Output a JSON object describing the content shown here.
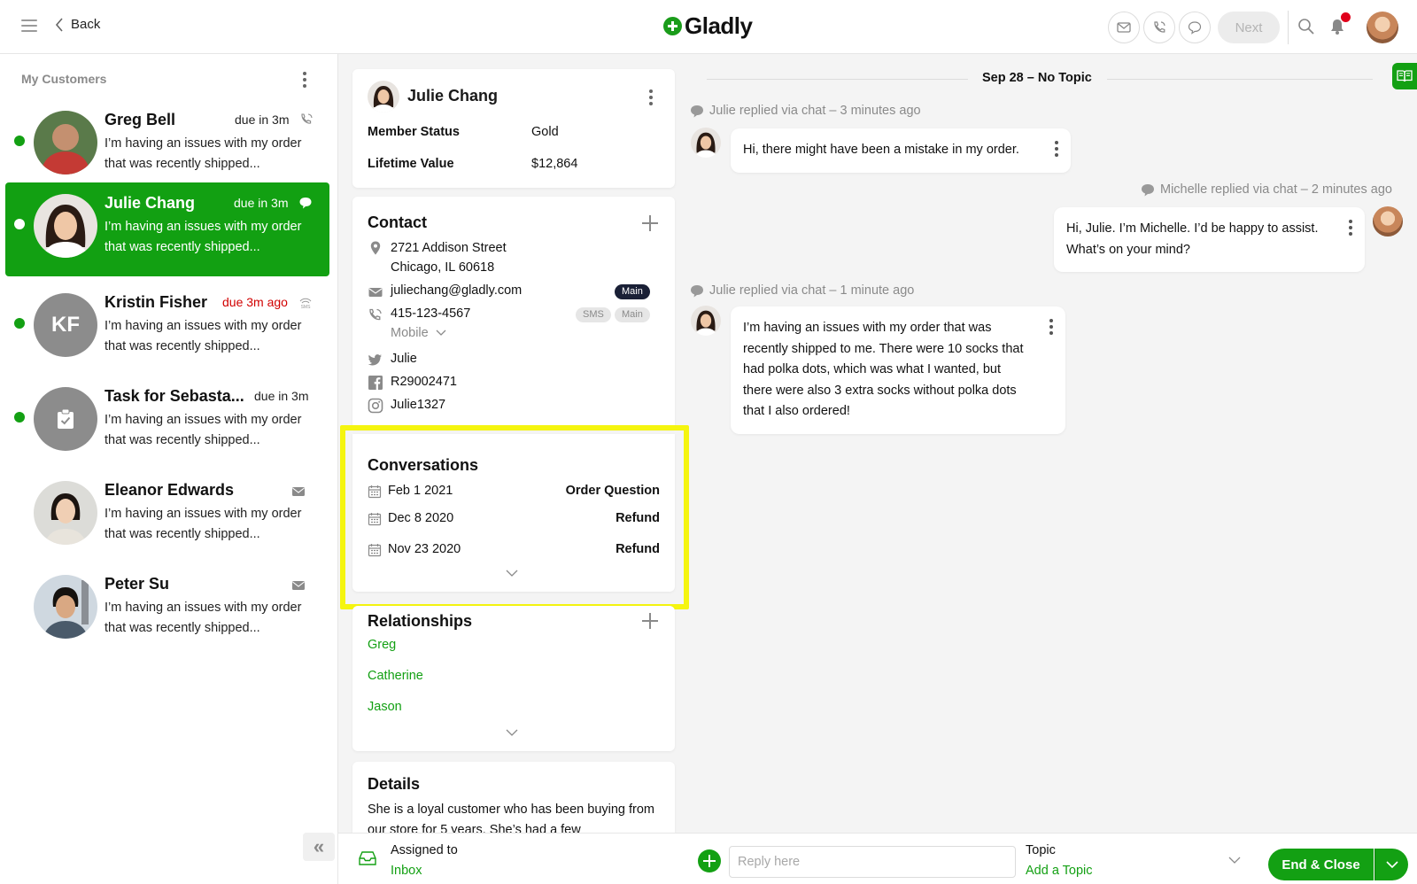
{
  "topbar": {
    "back_label": "Back",
    "logo_text": "Gladly",
    "next_label": "Next"
  },
  "sidebar": {
    "header": "My Customers",
    "customers": [
      {
        "name": "Greg Bell",
        "due": "due in 3m",
        "preview": "I’m having an issues with my order that was recently shipped...",
        "channel_icon": "phone-icon",
        "status": "online"
      },
      {
        "name": "Julie Chang",
        "due": "due in 3m",
        "preview": "I’m having an issues with my order that was recently shipped...",
        "channel_icon": "chat-icon",
        "status": "active"
      },
      {
        "name": "Kristin Fisher",
        "initials": "KF",
        "due": "due 3m ago",
        "preview": "I’m having an issues with my order that was recently shipped...",
        "channel_icon": "sms-icon",
        "status": "online"
      },
      {
        "name": "Task for Sebasta...",
        "due": "due in 3m",
        "preview": "I’m having an issues with my order that was recently shipped...",
        "channel_icon": "",
        "status": "online"
      },
      {
        "name": "Eleanor Edwards",
        "due": "",
        "preview": "I’m having an issues with my order that was recently shipped...",
        "channel_icon": "email-icon",
        "status": "none"
      },
      {
        "name": "Peter Su",
        "due": "",
        "preview": "I’m having an issues with my order that was recently shipped...",
        "channel_icon": "email-icon",
        "status": "none"
      }
    ]
  },
  "profile": {
    "name": "Julie Chang",
    "member_status_label": "Member Status",
    "member_status_value": "Gold",
    "lifetime_value_label": "Lifetime Value",
    "lifetime_value": "$12,864"
  },
  "contact": {
    "title": "Contact",
    "address_line1": "2721 Addison Street",
    "address_line2": "Chicago, IL 60618",
    "email": "juliechang@gladly.com",
    "email_badge": "Main",
    "phone": "415-123-4567",
    "phone_badge_sms": "SMS",
    "phone_badge_main": "Main",
    "phone_type": "Mobile",
    "twitter": "Julie",
    "facebook": "R29002471",
    "instagram": "Julie1327"
  },
  "conversations": {
    "title": "Conversations",
    "items": [
      {
        "date": "Feb 1 2021",
        "topic": "Order Question"
      },
      {
        "date": "Dec 8 2020",
        "topic": "Refund"
      },
      {
        "date": "Nov 23 2020",
        "topic": "Refund"
      }
    ]
  },
  "relationships": {
    "title": "Relationships",
    "people": [
      "Greg",
      "Catherine",
      "Jason"
    ]
  },
  "details": {
    "title": "Details",
    "text": "She is a loyal customer who has been buying from our store for 5 years. She’s had a few"
  },
  "thread": {
    "date_header": "Sep 28 – No Topic",
    "messages": [
      {
        "meta": "Julie replied via chat – 3 minutes ago",
        "text": "Hi, there might have been a mistake in my order.",
        "side": "left"
      },
      {
        "meta": "Michelle replied via chat – 2 minutes ago",
        "text": "Hi, Julie. I’m Michelle. I’d be happy to assist. What’s on your mind?",
        "side": "right"
      },
      {
        "meta": "Julie replied via chat – 1 minute ago",
        "text": "I’m having an issues with my order that was recently shipped to me. There were 10 socks that had polka dots, which was what I wanted, but there were also 3 extra socks without polka dots that I also ordered!",
        "side": "left"
      }
    ]
  },
  "bottom": {
    "assigned_label": "Assigned to",
    "assigned_value": "Inbox",
    "reply_placeholder": "Reply here",
    "topic_label": "Topic",
    "topic_value": "Add a Topic",
    "end_close_label": "End & Close"
  },
  "colors": {
    "brand_green": "#13a013",
    "alert_red": "#d10000",
    "highlight_yellow": "#f5f50f"
  }
}
